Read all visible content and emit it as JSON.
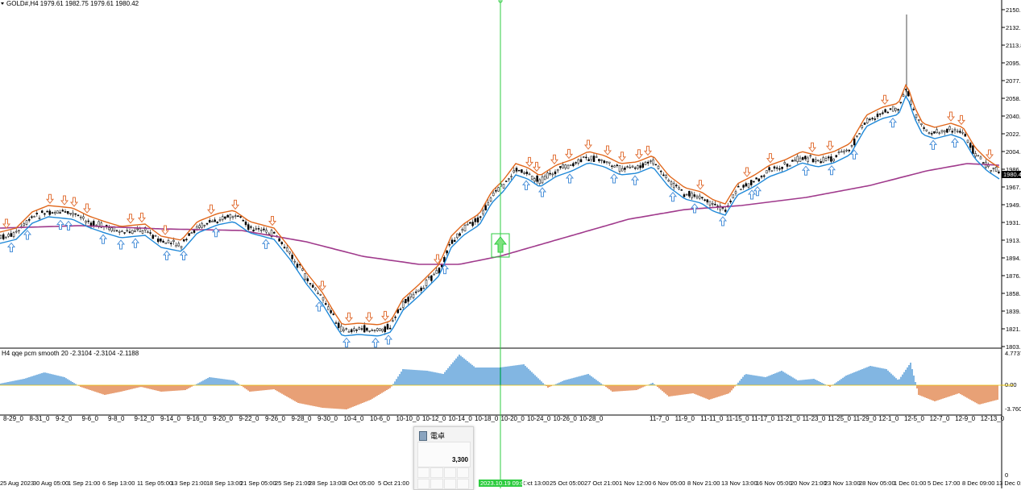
{
  "main_chart": {
    "header": "GOLD#,H4  1979.61 1982.75 1979.61 1980.42",
    "price_tag": "1980.42",
    "y_ticks": [
      "2150.1",
      "2132.0",
      "2113.8",
      "2095.7",
      "2077.5",
      "2058.8",
      "2040.7",
      "2022.5",
      "2004.4",
      "1986.2",
      "1967.5",
      "1949.4",
      "1931.2",
      "1913.0",
      "1894.9",
      "1876.2",
      "1858.1",
      "1839.9",
      "1821.8",
      "1803.6"
    ]
  },
  "sub_chart": {
    "header": "H4  qqe pcm smooth  20 -2.3104 -2.3104 -2.1188",
    "y_ticks": [
      "4.7737",
      "0.00",
      "-3.7602"
    ]
  },
  "x_axis": {
    "labels": [
      "25 Aug 2023",
      "30 Aug 05:00",
      "1 Sep 21:00",
      "6 Sep 13:00",
      "11 Sep 05:00",
      "13 Sep 21:00",
      "18 Sep 13:00",
      "21 Sep 05:00",
      "25 Sep 21:00",
      "28 Sep 13:00",
      "3 Oct 05:00",
      "5 Oct 21:00",
      "2023.10.19 09:00",
      "Oct 13:00",
      "25 Oct 05:00",
      "27 Oct 21:00",
      "1 Nov 12:00",
      "6 Nov 05:00",
      "8 Nov 21:00",
      "13 Nov 13:00",
      "16 Nov 05:00",
      "20 Nov 21:00",
      "23 Nov 13:00",
      "28 Nov 05:00",
      "1 Dec 01:00",
      "5 Dec 17:00",
      "8 Dec 09:00",
      "13 Dec 01:00"
    ],
    "secondary_labels_left": [
      "8-29_0",
      "8-31_0",
      "9-2_0",
      "9-6_0",
      "9-8_0",
      "9-12_0",
      "9-14_0",
      "9-16_0",
      "9-20_0",
      "9-22_0",
      "9-26_0",
      "9-28_0",
      "9-30_0",
      "10-4_0",
      "10-6_0",
      "10-10_0",
      "10-12_0",
      "10-14_0",
      "10-18_0",
      "10-20_0",
      "10-24_0",
      "10-26_0",
      "10-28_0"
    ],
    "secondary_labels_right": [
      "11-7_0",
      "11-9_0",
      "11-11_0",
      "11-15_0",
      "11-17_0",
      "11-21_0",
      "11-23_0",
      "11-25_0",
      "11-29_0",
      "12-1_0",
      "12-5_0",
      "12-7_0",
      "12-9_0",
      "12-13_0"
    ],
    "bottom_right": "0"
  },
  "crosshair_time": "2023.10.19 09:00",
  "calculator": {
    "title": "電卓",
    "value": "3,300"
  },
  "colors": {
    "bull_up_arrow": "#4a90d9",
    "bear_down_arrow": "#e2733a",
    "upper_line": "#e0661a",
    "lower_line": "#1e88d8",
    "ma_line": "#a03a8c",
    "histogram_pos": "#2f86cf",
    "histogram_neg": "#d9621b",
    "crosshair": "#2ecc40"
  }
}
